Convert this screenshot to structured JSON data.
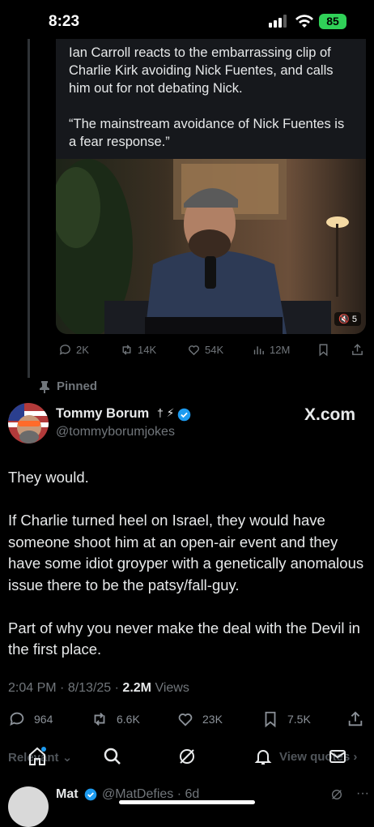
{
  "status_bar": {
    "time": "8:23",
    "battery": "85"
  },
  "quote_tweet": {
    "text": "Ian Carroll reacts to the embarrassing clip of Charlie Kirk avoiding Nick Fuentes, and calls him out for not debating Nick.\n\n“The mainstream avoidance of Nick Fuentes is a fear response.”",
    "video_badge": "5",
    "stats": {
      "replies": "2K",
      "reposts": "14K",
      "likes": "54K",
      "views": "12M"
    }
  },
  "pinned_label": "Pinned",
  "author": {
    "name": "Tommy Borum",
    "marks": "† ⚡",
    "handle": "@tommyborumjokes"
  },
  "source_label": "X.com",
  "tweet": {
    "body": "They would.\n\nIf Charlie turned heel on Israel, they would have someone shoot him at an open-air event and they have some idiot groyper with a genetically anomalous issue there to be the patsy/fall-guy.\n\nPart of why you never make the deal with the Devil in the first place.",
    "time": "2:04 PM",
    "date": "8/13/25",
    "views_count": "2.2M",
    "views_label": "Views"
  },
  "actions": {
    "replies": "964",
    "reposts": "6.6K",
    "likes": "23K",
    "bookmarks": "7.5K"
  },
  "sort_label": "Relevant",
  "view_quotes_label": "View quotes",
  "reply_preview": {
    "name": "Mat",
    "handle": "@MatDefies",
    "age": "6d"
  }
}
